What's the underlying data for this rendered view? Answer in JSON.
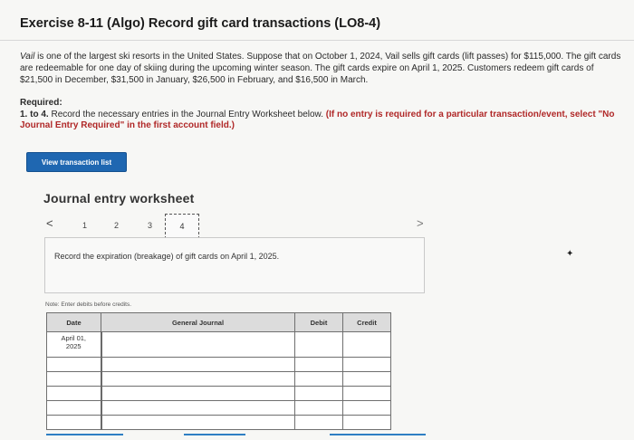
{
  "exercise": {
    "title": "Exercise 8-11 (Algo) Record gift card transactions (LO8-4)"
  },
  "problem": {
    "company": "Vail",
    "text": " is one of the largest ski resorts in the United States. Suppose that on October 1, 2024, Vail sells gift cards (lift passes) for $115,000. The gift cards are redeemable for one day of skiing during the upcoming winter season. The gift cards expire on April 1, 2025. Customers redeem gift cards of $21,500 in December, $31,500 in January, $26,500 in February, and $16,500 in March."
  },
  "required": {
    "heading": "Required:",
    "lead": "1. to 4.",
    "instruction": " Record the necessary entries in the Journal Entry Worksheet below. ",
    "emphasis": "(If no entry is required for a particular transaction/event, select \"No Journal Entry Required\" in the first account field.)"
  },
  "buttons": {
    "view_transaction_list": "View transaction list"
  },
  "worksheet": {
    "title": "Journal entry worksheet",
    "prev_glyph": "<",
    "next_glyph": ">",
    "steps": [
      "1",
      "2",
      "3",
      "4"
    ],
    "active_step": "4",
    "instruction": "Record the expiration (breakage) of gift cards on April 1, 2025.",
    "note": "Note: Enter debits before credits."
  },
  "journal": {
    "headers": {
      "date": "Date",
      "general_journal": "General Journal",
      "debit": "Debit",
      "credit": "Credit"
    },
    "date_line1": "April 01,",
    "date_line2": "2025"
  },
  "colors": {
    "button_bg": "#1f67b1",
    "emphasis_red": "#b02828",
    "header_gray": "#dcdcdc"
  }
}
